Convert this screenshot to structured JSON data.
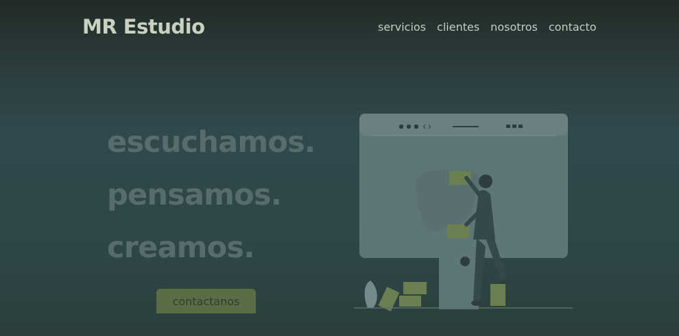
{
  "header": {
    "brand": "MR Estudio",
    "nav": [
      {
        "label": "servicios"
      },
      {
        "label": "clientes"
      },
      {
        "label": "nosotros"
      },
      {
        "label": "contacto"
      }
    ]
  },
  "hero": {
    "words": [
      "escuchamos.",
      "pensamos.",
      "creamos."
    ],
    "cta_label": "contactanos"
  },
  "illustration": {
    "name": "person-placing-notes-on-browser-window",
    "colors": {
      "window": "#5f7676",
      "window_bar": "#6b8181",
      "dots": "#2e3e3f",
      "notes": "#6b8050",
      "person": "#34494c",
      "bush": "#5a6f6f",
      "leaf": "#758b8b",
      "ground": "#56706d"
    }
  },
  "colors": {
    "background_top": "#222b27",
    "background_mid": "#31494d",
    "brand": "#c7d3be",
    "nav": "#c4cfbf",
    "hero_text": "#576d6d",
    "cta_bg": "#596e45",
    "cta_text": "#2d3c34"
  }
}
